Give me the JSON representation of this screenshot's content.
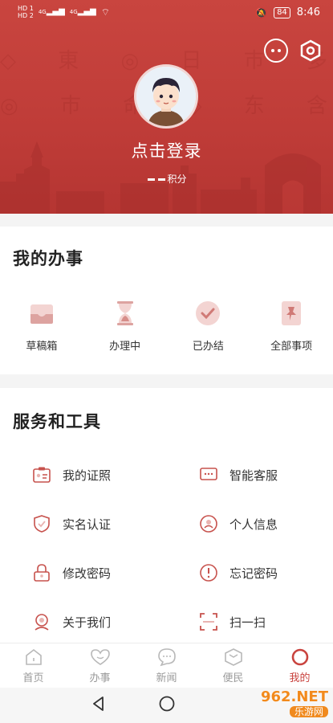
{
  "status_bar": {
    "network_1": "HD 1",
    "network_2": "HD 2",
    "signal_1": "4G",
    "signal_2": "4G",
    "battery": "84",
    "time": "8:46"
  },
  "header": {
    "login_text": "点击登录",
    "points_label": "积分",
    "bg_color": "#c4403b"
  },
  "my_affairs": {
    "title": "我的办事",
    "items": [
      {
        "label": "草稿箱",
        "icon": "draft-box-icon"
      },
      {
        "label": "办理中",
        "icon": "hourglass-icon"
      },
      {
        "label": "已办结",
        "icon": "check-circle-icon"
      },
      {
        "label": "全部事项",
        "icon": "all-items-icon"
      }
    ]
  },
  "services": {
    "title": "服务和工具",
    "items": [
      {
        "label": "我的证照",
        "icon": "license-icon"
      },
      {
        "label": "智能客服",
        "icon": "chat-service-icon"
      },
      {
        "label": "实名认证",
        "icon": "shield-check-icon"
      },
      {
        "label": "个人信息",
        "icon": "person-info-icon"
      },
      {
        "label": "修改密码",
        "icon": "lock-icon"
      },
      {
        "label": "忘记密码",
        "icon": "forgot-password-icon"
      },
      {
        "label": "关于我们",
        "icon": "about-us-icon"
      },
      {
        "label": "扫一扫",
        "icon": "scan-icon"
      }
    ]
  },
  "tab_bar": {
    "items": [
      {
        "label": "首页",
        "icon": "home-icon"
      },
      {
        "label": "办事",
        "icon": "heart-icon"
      },
      {
        "label": "新闻",
        "icon": "news-icon"
      },
      {
        "label": "便民",
        "icon": "convenience-icon"
      },
      {
        "label": "我的",
        "icon": "profile-icon"
      }
    ],
    "active_index": 4,
    "accent": "#c9433e"
  },
  "watermark": {
    "top": "962.NET",
    "bottom": "乐游网"
  }
}
